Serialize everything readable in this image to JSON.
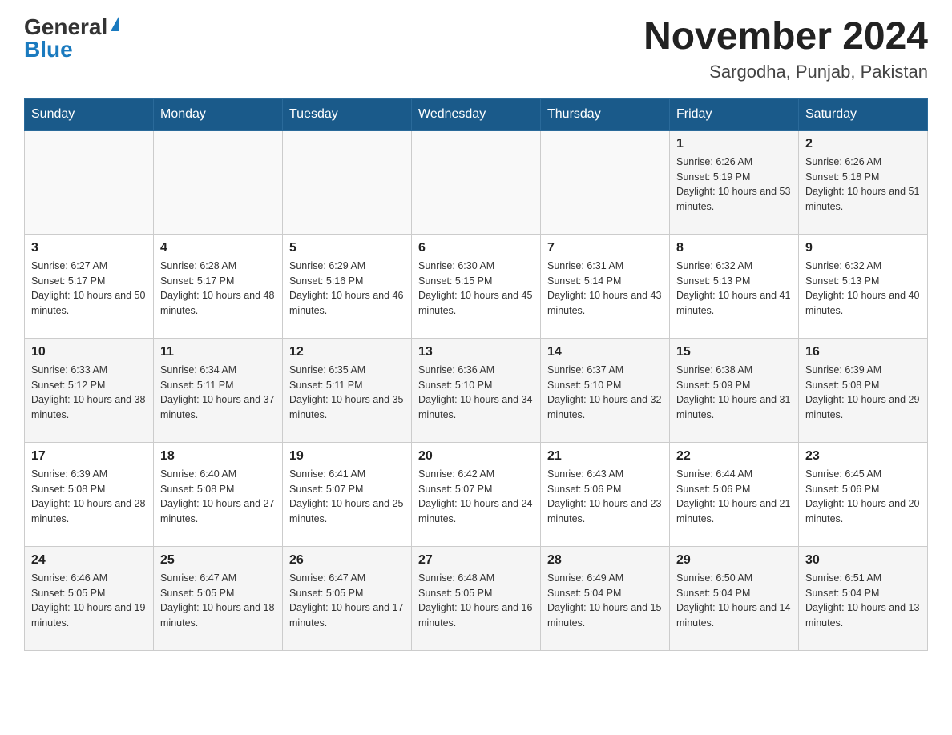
{
  "header": {
    "logo_general": "General",
    "logo_blue": "Blue",
    "month_title": "November 2024",
    "location": "Sargodha, Punjab, Pakistan"
  },
  "days_of_week": [
    "Sunday",
    "Monday",
    "Tuesday",
    "Wednesday",
    "Thursday",
    "Friday",
    "Saturday"
  ],
  "weeks": [
    [
      {
        "day": "",
        "info": ""
      },
      {
        "day": "",
        "info": ""
      },
      {
        "day": "",
        "info": ""
      },
      {
        "day": "",
        "info": ""
      },
      {
        "day": "",
        "info": ""
      },
      {
        "day": "1",
        "info": "Sunrise: 6:26 AM\nSunset: 5:19 PM\nDaylight: 10 hours and 53 minutes."
      },
      {
        "day": "2",
        "info": "Sunrise: 6:26 AM\nSunset: 5:18 PM\nDaylight: 10 hours and 51 minutes."
      }
    ],
    [
      {
        "day": "3",
        "info": "Sunrise: 6:27 AM\nSunset: 5:17 PM\nDaylight: 10 hours and 50 minutes."
      },
      {
        "day": "4",
        "info": "Sunrise: 6:28 AM\nSunset: 5:17 PM\nDaylight: 10 hours and 48 minutes."
      },
      {
        "day": "5",
        "info": "Sunrise: 6:29 AM\nSunset: 5:16 PM\nDaylight: 10 hours and 46 minutes."
      },
      {
        "day": "6",
        "info": "Sunrise: 6:30 AM\nSunset: 5:15 PM\nDaylight: 10 hours and 45 minutes."
      },
      {
        "day": "7",
        "info": "Sunrise: 6:31 AM\nSunset: 5:14 PM\nDaylight: 10 hours and 43 minutes."
      },
      {
        "day": "8",
        "info": "Sunrise: 6:32 AM\nSunset: 5:13 PM\nDaylight: 10 hours and 41 minutes."
      },
      {
        "day": "9",
        "info": "Sunrise: 6:32 AM\nSunset: 5:13 PM\nDaylight: 10 hours and 40 minutes."
      }
    ],
    [
      {
        "day": "10",
        "info": "Sunrise: 6:33 AM\nSunset: 5:12 PM\nDaylight: 10 hours and 38 minutes."
      },
      {
        "day": "11",
        "info": "Sunrise: 6:34 AM\nSunset: 5:11 PM\nDaylight: 10 hours and 37 minutes."
      },
      {
        "day": "12",
        "info": "Sunrise: 6:35 AM\nSunset: 5:11 PM\nDaylight: 10 hours and 35 minutes."
      },
      {
        "day": "13",
        "info": "Sunrise: 6:36 AM\nSunset: 5:10 PM\nDaylight: 10 hours and 34 minutes."
      },
      {
        "day": "14",
        "info": "Sunrise: 6:37 AM\nSunset: 5:10 PM\nDaylight: 10 hours and 32 minutes."
      },
      {
        "day": "15",
        "info": "Sunrise: 6:38 AM\nSunset: 5:09 PM\nDaylight: 10 hours and 31 minutes."
      },
      {
        "day": "16",
        "info": "Sunrise: 6:39 AM\nSunset: 5:08 PM\nDaylight: 10 hours and 29 minutes."
      }
    ],
    [
      {
        "day": "17",
        "info": "Sunrise: 6:39 AM\nSunset: 5:08 PM\nDaylight: 10 hours and 28 minutes."
      },
      {
        "day": "18",
        "info": "Sunrise: 6:40 AM\nSunset: 5:08 PM\nDaylight: 10 hours and 27 minutes."
      },
      {
        "day": "19",
        "info": "Sunrise: 6:41 AM\nSunset: 5:07 PM\nDaylight: 10 hours and 25 minutes."
      },
      {
        "day": "20",
        "info": "Sunrise: 6:42 AM\nSunset: 5:07 PM\nDaylight: 10 hours and 24 minutes."
      },
      {
        "day": "21",
        "info": "Sunrise: 6:43 AM\nSunset: 5:06 PM\nDaylight: 10 hours and 23 minutes."
      },
      {
        "day": "22",
        "info": "Sunrise: 6:44 AM\nSunset: 5:06 PM\nDaylight: 10 hours and 21 minutes."
      },
      {
        "day": "23",
        "info": "Sunrise: 6:45 AM\nSunset: 5:06 PM\nDaylight: 10 hours and 20 minutes."
      }
    ],
    [
      {
        "day": "24",
        "info": "Sunrise: 6:46 AM\nSunset: 5:05 PM\nDaylight: 10 hours and 19 minutes."
      },
      {
        "day": "25",
        "info": "Sunrise: 6:47 AM\nSunset: 5:05 PM\nDaylight: 10 hours and 18 minutes."
      },
      {
        "day": "26",
        "info": "Sunrise: 6:47 AM\nSunset: 5:05 PM\nDaylight: 10 hours and 17 minutes."
      },
      {
        "day": "27",
        "info": "Sunrise: 6:48 AM\nSunset: 5:05 PM\nDaylight: 10 hours and 16 minutes."
      },
      {
        "day": "28",
        "info": "Sunrise: 6:49 AM\nSunset: 5:04 PM\nDaylight: 10 hours and 15 minutes."
      },
      {
        "day": "29",
        "info": "Sunrise: 6:50 AM\nSunset: 5:04 PM\nDaylight: 10 hours and 14 minutes."
      },
      {
        "day": "30",
        "info": "Sunrise: 6:51 AM\nSunset: 5:04 PM\nDaylight: 10 hours and 13 minutes."
      }
    ]
  ]
}
